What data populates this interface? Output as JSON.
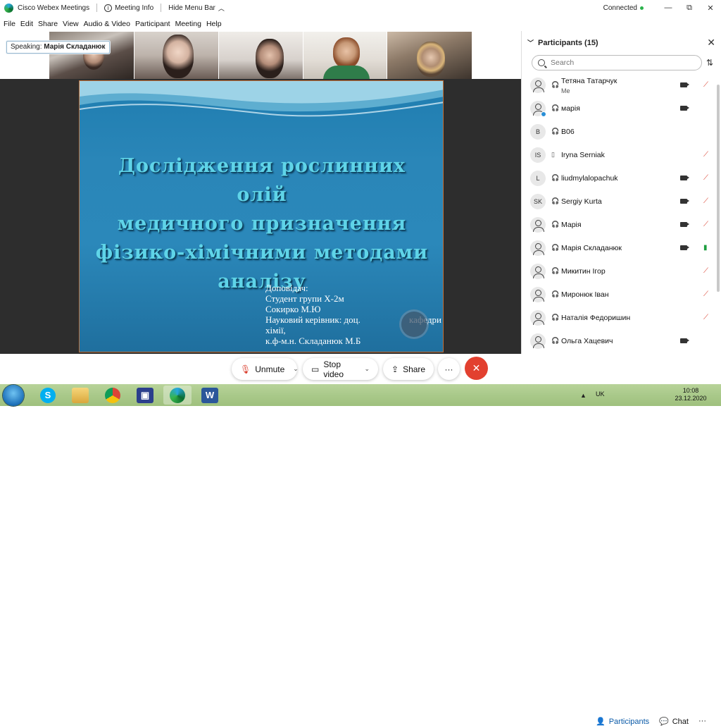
{
  "titlebar": {
    "app_title": "Cisco Webex Meetings",
    "meeting_info": "Meeting Info",
    "hide_menu_bar": "Hide Menu Bar",
    "status": "Connected",
    "status_color": "#2bb24c",
    "window_controls": [
      "—",
      "⧉",
      "✕"
    ]
  },
  "menubar": {
    "items": [
      "File",
      "Edit",
      "Share",
      "View",
      "Audio & Video",
      "Participant",
      "Meeting",
      "Help"
    ]
  },
  "speaking": {
    "label": "Speaking:",
    "name": "Марія Складанюк"
  },
  "slide": {
    "title_lines": [
      "Дослідження рослинних олій",
      "медичного призначення",
      "фізико-хімічними методами",
      "аналізу"
    ],
    "author_lines": [
      "Доповідач:",
      "Студент групи Х-2м",
      "Сокирко М.Ю"
    ],
    "advisor_left": "Науковий  керівник:  доц.",
    "advisor_right": "кафедри",
    "author_tail": [
      "хімії,",
      "к.ф-м.н. Складанюк М.Б"
    ]
  },
  "panel": {
    "title": "Participants (15)",
    "search_placeholder": "Search",
    "participants": [
      {
        "initials": "",
        "name": "Тетяна Татарчук",
        "sub": "Me",
        "camera": true,
        "mic": "muted",
        "host": false
      },
      {
        "initials": "",
        "name": "марія",
        "sub": "",
        "camera": true,
        "mic": "none",
        "host": true
      },
      {
        "initials": "B",
        "name": "B06",
        "sub": "",
        "camera": false,
        "mic": "none",
        "host": false
      },
      {
        "initials": "IS",
        "name": "Iryna Serniak",
        "sub": "",
        "camera": false,
        "mic": "muted",
        "host": false
      },
      {
        "initials": "L",
        "name": "liudmylalopachuk",
        "sub": "",
        "camera": true,
        "mic": "muted",
        "host": false
      },
      {
        "initials": "SK",
        "name": "Sergiy Kurta",
        "sub": "",
        "camera": true,
        "mic": "muted",
        "host": false
      },
      {
        "initials": "",
        "name": "Марія",
        "sub": "",
        "camera": true,
        "mic": "muted",
        "host": false
      },
      {
        "initials": "",
        "name": "Марія Складанюк",
        "sub": "",
        "camera": true,
        "mic": "live",
        "host": false
      },
      {
        "initials": "",
        "name": "Микитин Ігор",
        "sub": "",
        "camera": false,
        "mic": "muted",
        "host": false
      },
      {
        "initials": "",
        "name": "Миронюк Іван",
        "sub": "",
        "camera": false,
        "mic": "muted",
        "host": false
      },
      {
        "initials": "",
        "name": "Наталія Федоришин",
        "sub": "",
        "camera": false,
        "mic": "muted",
        "host": false
      },
      {
        "initials": "",
        "name": "Ольга Хацевич",
        "sub": "",
        "camera": true,
        "mic": "none",
        "host": false
      }
    ]
  },
  "controls": {
    "unmute": "Unmute",
    "stop_video": "Stop video",
    "share": "Share",
    "more": "···",
    "participants": "Participants",
    "chat": "Chat",
    "leave_color": "#e2402f"
  },
  "taskbar": {
    "lang": "UK",
    "time": "10:08",
    "date": "23.12.2020"
  }
}
